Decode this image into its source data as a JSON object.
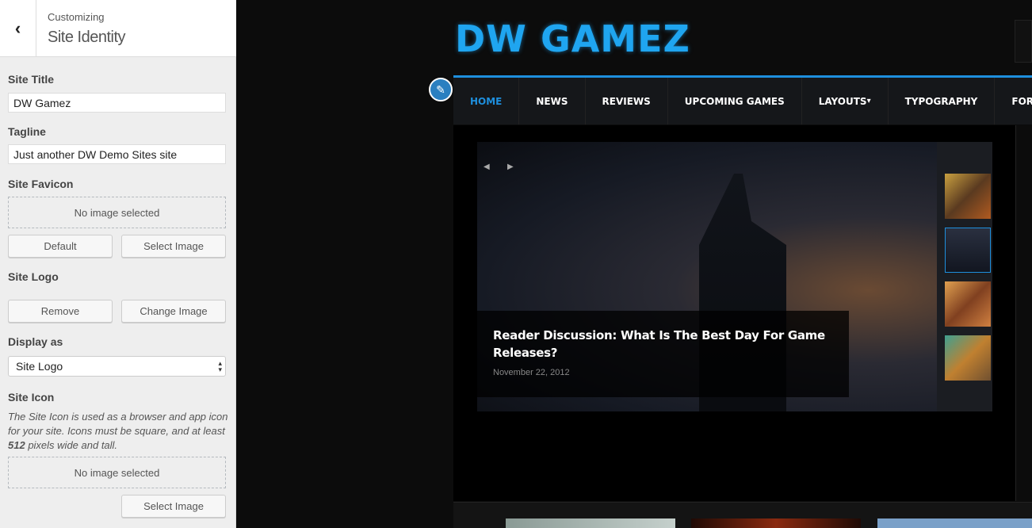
{
  "sidebar": {
    "header": {
      "subtitle": "Customizing",
      "title": "Site Identity"
    },
    "site_title": {
      "label": "Site Title",
      "value": "DW Gamez"
    },
    "tagline": {
      "label": "Tagline",
      "value": "Just another DW Demo Sites site"
    },
    "favicon": {
      "label": "Site Favicon",
      "placeholder": "No image selected",
      "default_btn": "Default",
      "select_btn": "Select Image"
    },
    "logo": {
      "label": "Site Logo",
      "remove_btn": "Remove",
      "change_btn": "Change Image"
    },
    "display_as": {
      "label": "Display as",
      "value": "Site Logo"
    },
    "site_icon": {
      "label": "Site Icon",
      "desc_1": "The Site Icon is used as a browser and app icon for your site. Icons must be square, and at least ",
      "desc_bold": "512",
      "desc_2": " pixels wide and tall.",
      "placeholder": "No image selected",
      "select_btn": "Select Image"
    }
  },
  "preview": {
    "logo_text": "DW GAMEZ",
    "accent": "#1e8fdd",
    "nav": [
      {
        "label": "HOME",
        "active": true
      },
      {
        "label": "NEWS"
      },
      {
        "label": "REVIEWS"
      },
      {
        "label": "UPCOMING GAMES"
      },
      {
        "label": "LAYOUTS",
        "dropdown": true
      },
      {
        "label": "TYPOGRAPHY"
      },
      {
        "label": "FORUM",
        "dropdown": true
      }
    ],
    "slider": {
      "title": "Reader Discussion: What Is The Best Day For Game Releases?",
      "date": "November 22, 2012"
    }
  }
}
